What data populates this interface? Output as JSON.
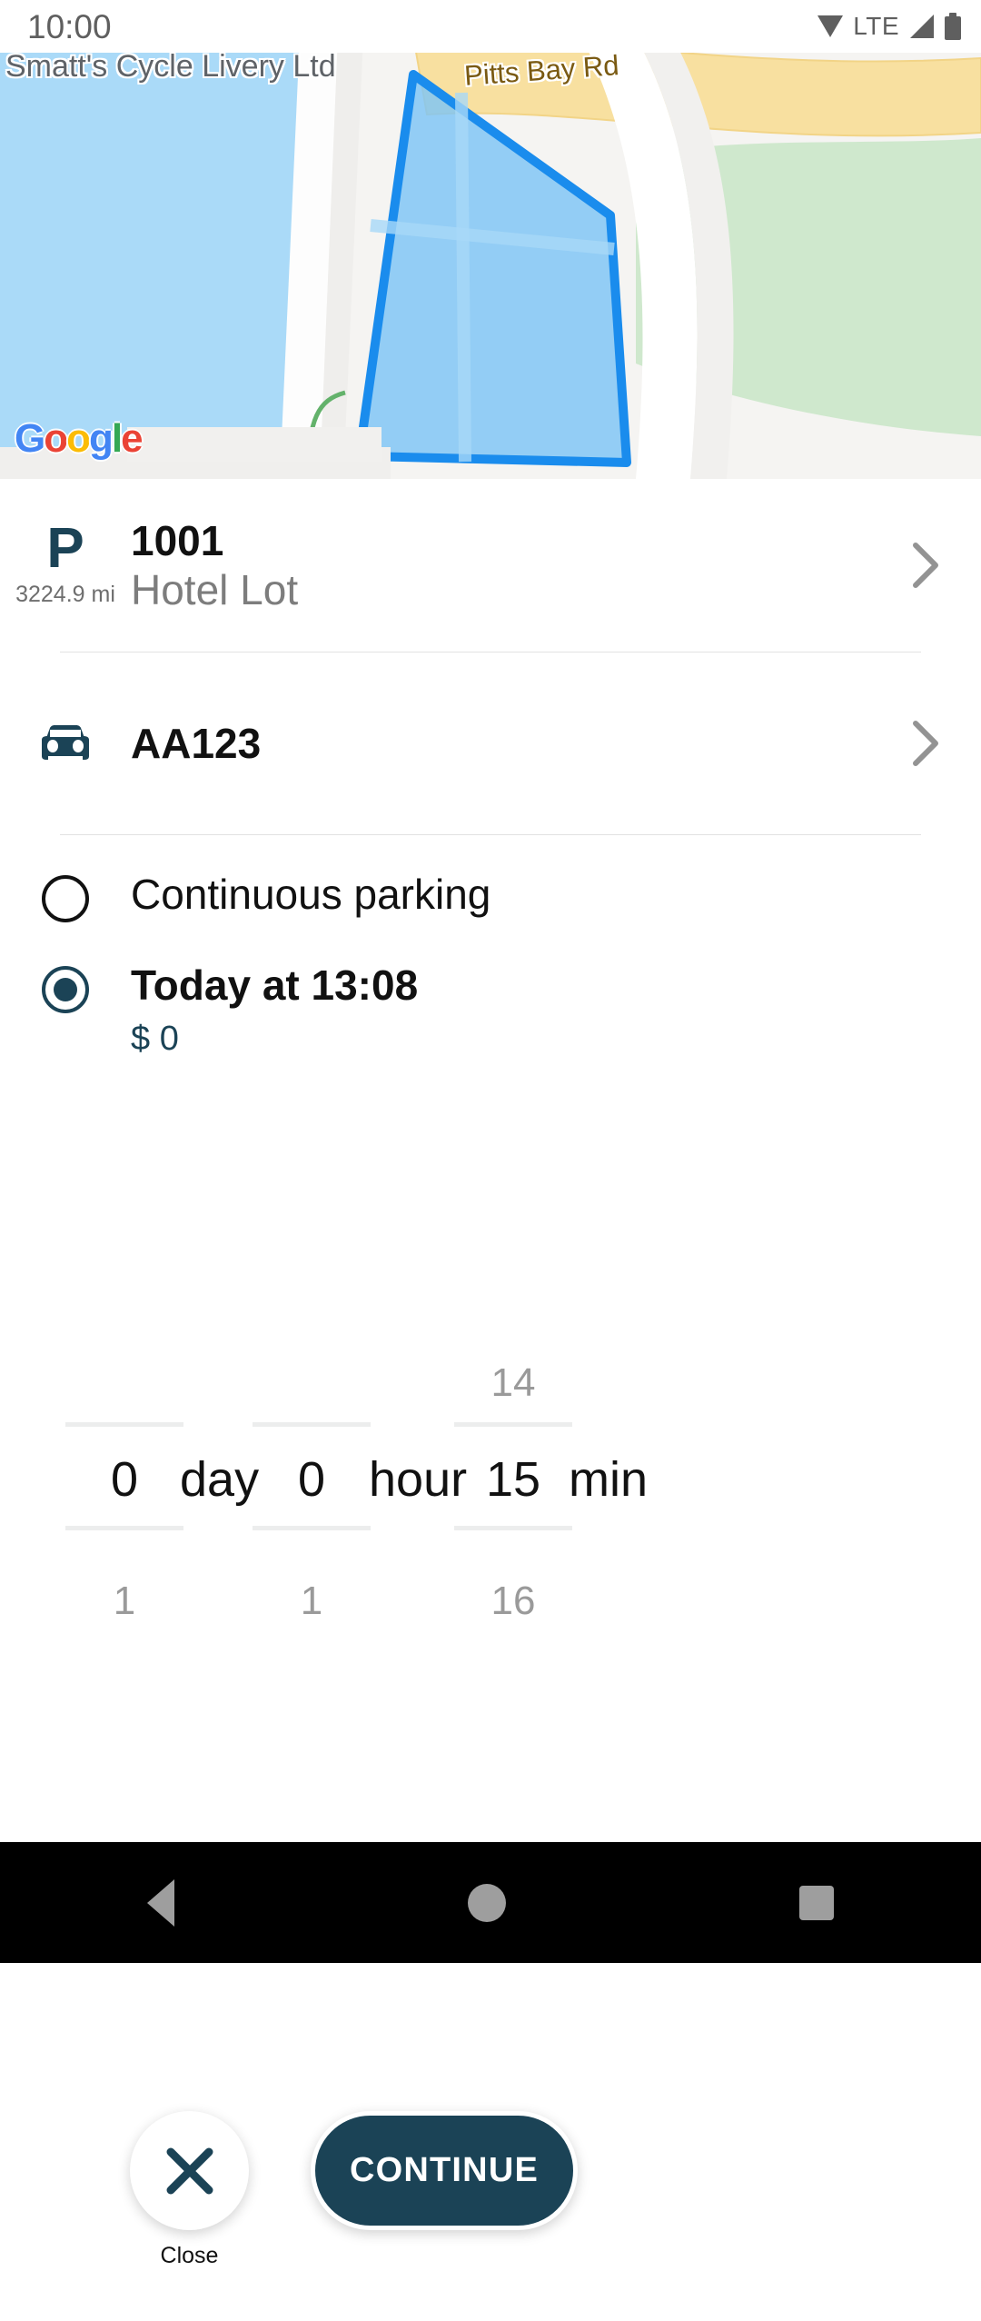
{
  "status_bar": {
    "time": "10:00",
    "network": "LTE",
    "icons": [
      "wifi-icon",
      "signal-icon",
      "battery-icon"
    ]
  },
  "map": {
    "place_label": "Smatt's Cycle Livery Ltd",
    "street_label": "Pitts Bay Rd",
    "attribution": "Google",
    "logo_letters": [
      "G",
      "o",
      "o",
      "g",
      "l",
      "e"
    ],
    "highlight_color": "#1a8ced"
  },
  "lot": {
    "icon": "parking-p-icon",
    "distance": "3224.9 mi",
    "number": "1001",
    "name": "Hotel Lot",
    "chevron": "chevron-right-icon"
  },
  "vehicle": {
    "icon": "car-icon",
    "plate": "AA123",
    "chevron": "chevron-right-icon"
  },
  "duration_options": [
    {
      "label": "Continuous parking",
      "selected": false,
      "price": ""
    },
    {
      "label": "Today at 13:08",
      "selected": true,
      "price": "$ 0"
    }
  ],
  "picker": {
    "columns": [
      {
        "unit": "day",
        "value": "0",
        "prev": "",
        "next": "1"
      },
      {
        "unit": "hour",
        "value": "0",
        "prev": "",
        "next": "1"
      },
      {
        "unit": "min",
        "value": "15",
        "prev": "14",
        "next": "16"
      }
    ]
  },
  "actions": {
    "close_icon": "close-x-icon",
    "close_label": "Close",
    "continue_label": "CONTINUE",
    "accent_color": "#1b4356"
  },
  "nav_bar": {
    "back": "back-triangle-icon",
    "home": "home-circle-icon",
    "recents": "recents-square-icon"
  }
}
